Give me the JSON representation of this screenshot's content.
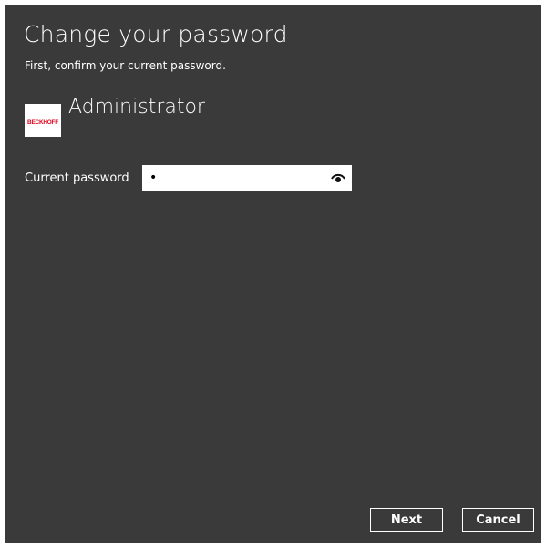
{
  "dialog": {
    "title": "Change your password",
    "subtitle": "First, confirm your current password."
  },
  "user": {
    "name": "Administrator",
    "logo_text": "BECKHOFF"
  },
  "form": {
    "current_password_label": "Current password",
    "current_password_value": "•",
    "reveal_icon": "eye-icon"
  },
  "buttons": {
    "next_label": "Next",
    "cancel_label": "Cancel"
  },
  "colors": {
    "background": "#3a3a3a",
    "text": "#ffffff",
    "logo_red": "#e2001a"
  }
}
